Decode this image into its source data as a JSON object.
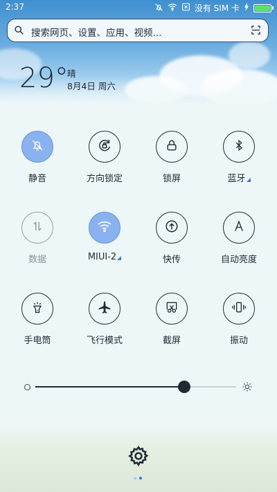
{
  "status_bar": {
    "time": "2:37",
    "sim_text": "没有 SIM 卡",
    "battery_level": 0.95
  },
  "search": {
    "placeholder": "搜索网页、设置、应用、视频..."
  },
  "weather": {
    "temperature": "29°",
    "condition": "晴",
    "date": "8月4日 周六"
  },
  "toggles": [
    {
      "label": "静音",
      "icon": "bell-off-icon",
      "state": "active"
    },
    {
      "label": "方向锁定",
      "icon": "rotation-lock-icon",
      "state": "off"
    },
    {
      "label": "锁屏",
      "icon": "lock-icon",
      "state": "off"
    },
    {
      "label": "蓝牙",
      "icon": "bluetooth-icon",
      "state": "off",
      "has_menu": true
    },
    {
      "label": "数据",
      "icon": "mobile-data-icon",
      "state": "disabled"
    },
    {
      "label": "MIUI-2",
      "icon": "wifi-icon",
      "state": "active",
      "has_menu": true
    },
    {
      "label": "快传",
      "icon": "quick-share-icon",
      "state": "off"
    },
    {
      "label": "自动亮度",
      "icon": "auto-brightness-icon",
      "state": "off"
    },
    {
      "label": "手电筒",
      "icon": "flashlight-icon",
      "state": "off"
    },
    {
      "label": "飞行模式",
      "icon": "airplane-icon",
      "state": "off"
    },
    {
      "label": "截屏",
      "icon": "screenshot-icon",
      "state": "off"
    },
    {
      "label": "振动",
      "icon": "vibrate-icon",
      "state": "off"
    }
  ],
  "brightness": {
    "level": 0.74
  },
  "pager": {
    "pages": 2,
    "current": 2
  },
  "colors": {
    "active_toggle": "#8ab2f0",
    "accent": "#3a78d6"
  }
}
